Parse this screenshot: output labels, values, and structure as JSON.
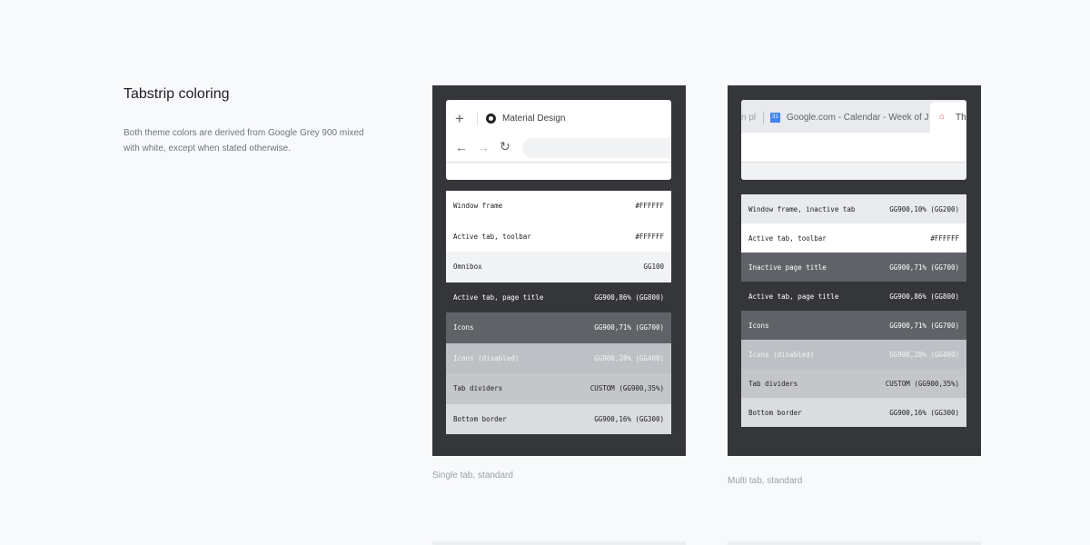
{
  "section": {
    "title": "Tabstrip coloring",
    "description": "Both theme colors are derived from Google Grey 900 mixed with white, except when stated otherwise."
  },
  "single": {
    "caption": "Single tab, standard",
    "tab_title": "Material Design",
    "rows": [
      {
        "label": "Window frame",
        "value": "#FFFFFF",
        "bg": "#ffffff",
        "fg": "#202124"
      },
      {
        "label": "Active tab, toolbar",
        "value": "#FFFFFF",
        "bg": "#ffffff",
        "fg": "#202124"
      },
      {
        "label": "Omnibox",
        "value": "GG100",
        "bg": "#f1f3f4",
        "fg": "#202124"
      },
      {
        "label": "Active tab, page title",
        "value": "GG900,86% (GG800)",
        "bg": "#35363a",
        "fg": "#ffffff"
      },
      {
        "label": "Icons",
        "value": "GG900,71% (GG700)",
        "bg": "#5f6368",
        "fg": "#ffffff"
      },
      {
        "label": "Icons (disabled)",
        "value": "GG900,28% (GG400)",
        "bg": "#bdc1c6",
        "fg": "#f1f3f4"
      },
      {
        "label": "Tab dividers",
        "value": "CUSTOM (GG900,35%)",
        "bg": "#c4c6ca",
        "fg": "#202124"
      },
      {
        "label": "Bottom border",
        "value": "GG900,16% (GG300)",
        "bg": "#dadce0",
        "fg": "#202124"
      }
    ]
  },
  "multi": {
    "caption": "Multi tab, standard",
    "tabs": [
      "n pl",
      "Google.com - Calendar - Week of J",
      "Th"
    ],
    "calendar_icon_text": "31",
    "rows": [
      {
        "label": "Window frame, inactive tab",
        "value": "GG900,10% (GG200)",
        "bg": "#e8eaed",
        "fg": "#202124"
      },
      {
        "label": "Active tab, toolbar",
        "value": "#FFFFFF",
        "bg": "#ffffff",
        "fg": "#202124"
      },
      {
        "label": "Inactive page title",
        "value": "GG900,71% (GG700)",
        "bg": "#5f6368",
        "fg": "#ffffff"
      },
      {
        "label": "Active tab, page title",
        "value": "GG900,86% (GG800)",
        "bg": "#35363a",
        "fg": "#ffffff"
      },
      {
        "label": "Icons",
        "value": "GG900,71% (GG700)",
        "bg": "#5f6368",
        "fg": "#ffffff"
      },
      {
        "label": "Icons (disabled)",
        "value": "GG900,28% (GG400)",
        "bg": "#bdc1c6",
        "fg": "#f1f3f4"
      },
      {
        "label": "Tab dividers",
        "value": "CUSTOM (GG900,35%)",
        "bg": "#c4c6ca",
        "fg": "#202124"
      },
      {
        "label": "Bottom border",
        "value": "GG900,16% (GG300)",
        "bg": "#dadce0",
        "fg": "#202124"
      }
    ]
  }
}
